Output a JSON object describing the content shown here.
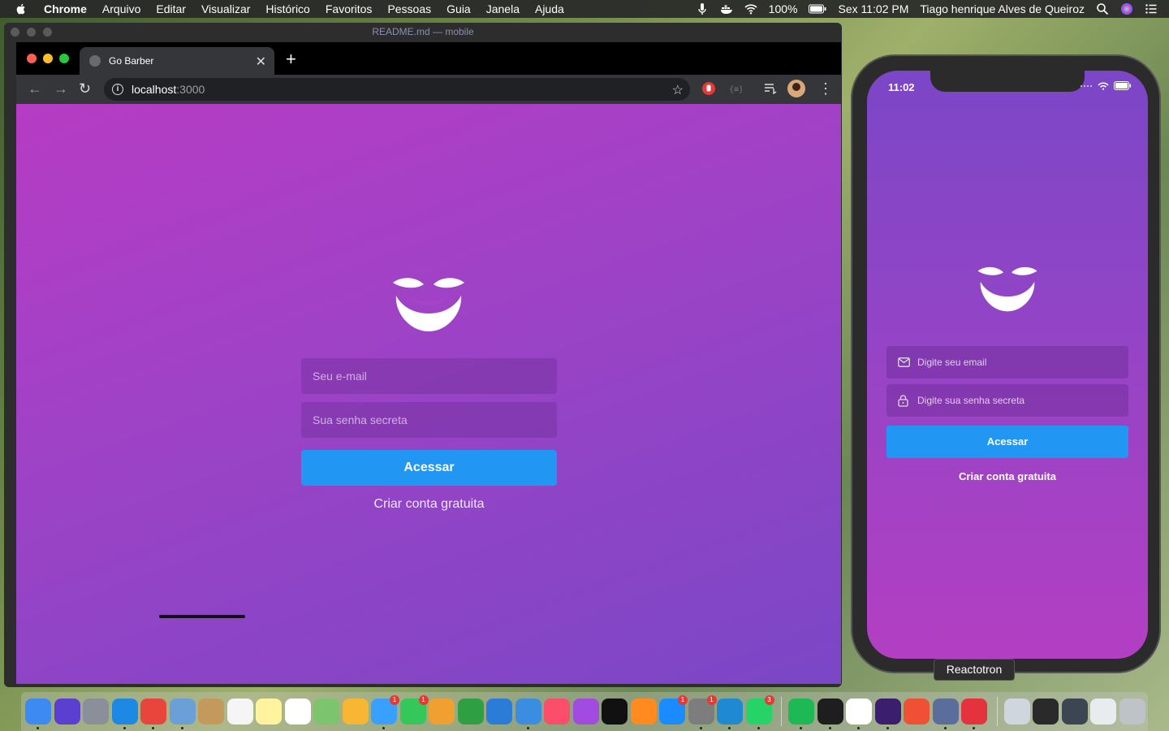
{
  "menubar": {
    "app_name": "Chrome",
    "items": [
      "Arquivo",
      "Editar",
      "Visualizar",
      "Histórico",
      "Favoritos",
      "Pessoas",
      "Guia",
      "Janela",
      "Ajuda"
    ],
    "battery": "100%",
    "clock": "Sex 11:02 PM",
    "user": "Tiago henrique Alves de Queiroz"
  },
  "background_window": {
    "title": "README.md — mobile"
  },
  "browser": {
    "tab_title": "Go Barber",
    "url_host": "localhost",
    "url_port": ":3000"
  },
  "web_login": {
    "email_placeholder": "Seu e-mail",
    "password_placeholder": "Sua senha secreta",
    "submit_label": "Acessar",
    "signup_link": "Criar conta gratuita"
  },
  "phone": {
    "time": "11:02",
    "email_placeholder": "Digite seu email",
    "password_placeholder": "Digite sua senha secreta",
    "submit_label": "Acessar",
    "signup_link": "Criar conta gratuita"
  },
  "tooltip": {
    "text": "Reactotron"
  },
  "dock": {
    "apps": [
      {
        "name": "finder-icon",
        "color": "#3d8bf2",
        "badge": "",
        "running": true
      },
      {
        "name": "siri-icon",
        "color": "#5b3fd1",
        "badge": "",
        "running": false
      },
      {
        "name": "launchpad-icon",
        "color": "#8a8f99",
        "badge": "",
        "running": false
      },
      {
        "name": "safari-icon",
        "color": "#1e88e5",
        "badge": "",
        "running": true
      },
      {
        "name": "chrome-icon",
        "color": "#e8453c",
        "badge": "",
        "running": true
      },
      {
        "name": "preview-icon",
        "color": "#6a9fd8",
        "badge": "",
        "running": true
      },
      {
        "name": "contacts-icon",
        "color": "#c49a5c",
        "badge": "",
        "running": false
      },
      {
        "name": "calendar-icon",
        "color": "#f5f5f5",
        "badge": "",
        "running": false
      },
      {
        "name": "notes-icon",
        "color": "#fff3a0",
        "badge": "",
        "running": false
      },
      {
        "name": "reminders-icon",
        "color": "#ffffff",
        "badge": "",
        "running": false
      },
      {
        "name": "maps-icon",
        "color": "#7cc46e",
        "badge": "",
        "running": false
      },
      {
        "name": "photos-icon",
        "color": "#f7b733",
        "badge": "",
        "running": false
      },
      {
        "name": "messages-icon",
        "color": "#3aa0ff",
        "badge": "1",
        "running": true
      },
      {
        "name": "facetime-icon",
        "color": "#34c759",
        "badge": "1",
        "running": false
      },
      {
        "name": "pages-icon",
        "color": "#f0a030",
        "badge": "",
        "running": false
      },
      {
        "name": "numbers-icon",
        "color": "#2ea043",
        "badge": "",
        "running": false
      },
      {
        "name": "keynote-icon",
        "color": "#2b7cd8",
        "badge": "",
        "running": false
      },
      {
        "name": "keynote-podium-icon",
        "color": "#3a8de0",
        "badge": "",
        "running": true
      },
      {
        "name": "music-icon",
        "color": "#fa4e6a",
        "badge": "",
        "running": false
      },
      {
        "name": "podcasts-icon",
        "color": "#a24be0",
        "badge": "",
        "running": false
      },
      {
        "name": "tv-icon",
        "color": "#111111",
        "badge": "",
        "running": false
      },
      {
        "name": "books-icon",
        "color": "#ff8a1f",
        "badge": "",
        "running": false
      },
      {
        "name": "app-store-icon",
        "color": "#1a8cff",
        "badge": "1",
        "running": false
      },
      {
        "name": "system-preferences-icon",
        "color": "#7d7d7d",
        "badge": "1",
        "running": true
      },
      {
        "name": "vscode-icon",
        "color": "#1f8ad2",
        "badge": "",
        "running": true
      },
      {
        "name": "whatsapp-icon",
        "color": "#25d366",
        "badge": "3",
        "running": true
      },
      {
        "name": "spotify-icon",
        "color": "#1db954",
        "badge": "",
        "running": true
      },
      {
        "name": "terminal-icon",
        "color": "#1e1e1e",
        "badge": "",
        "running": true
      },
      {
        "name": "slack-icon",
        "color": "#ffffff",
        "badge": "",
        "running": true
      },
      {
        "name": "hyper-icon",
        "color": "#3b1f6e",
        "badge": "",
        "running": true
      },
      {
        "name": "git-client-icon",
        "color": "#f05033",
        "badge": "",
        "running": false
      },
      {
        "name": "tableplus-icon",
        "color": "#5b6d9a",
        "badge": "",
        "running": true
      },
      {
        "name": "reactotron-icon",
        "color": "#e5333d",
        "badge": "",
        "running": true
      }
    ],
    "stacks": [
      {
        "name": "folder-stack-icon",
        "color": "#cfd6de"
      },
      {
        "name": "screenshot-stack-icon",
        "color": "#2a2a2a"
      },
      {
        "name": "desktop-stack-icon",
        "color": "#3c4552"
      },
      {
        "name": "downloads-stack-icon",
        "color": "#e8ecef"
      },
      {
        "name": "trash-icon",
        "color": "#bfc3c7"
      }
    ]
  }
}
